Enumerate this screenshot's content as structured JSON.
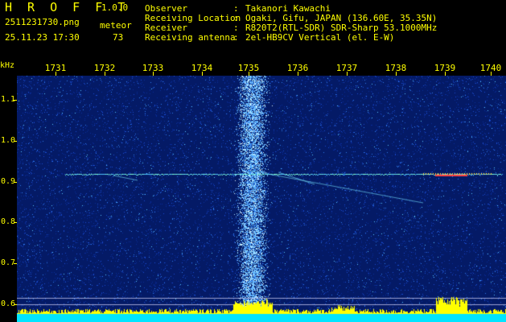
{
  "header": {
    "app_title": "H R O F F T",
    "version": "1.0.0",
    "file_name": "2511231730.png",
    "timestamp": "25.11.23 17:30",
    "meteor_label": "meteor",
    "meteor_count": "73",
    "info": [
      {
        "label": "Observer",
        "value": "Takanori Kawachi"
      },
      {
        "label": "Receiving Location",
        "value": "Ogaki, Gifu, JAPAN (136.60E, 35.35N)"
      },
      {
        "label": "Receiver",
        "value": "R820T2(RTL-SDR) SDR-Sharp 53.1000MHz"
      },
      {
        "label": "Receiving antenna",
        "value": "2el-HB9CV Vertical (el. E-W)"
      }
    ]
  },
  "axes": {
    "y_unit": "kHz",
    "x_ticks": [
      "1731",
      "1732",
      "1733",
      "1734",
      "1735",
      "1736",
      "1737",
      "1738",
      "1739",
      "1740"
    ],
    "y_ticks": [
      "1.1",
      "1.0",
      "0.9",
      "0.8",
      "0.7",
      "0.6"
    ]
  },
  "colors": {
    "background": "#041a66",
    "axis": "#ffff00",
    "noise_band": "#8fd0ff",
    "trace": "#7fffd4",
    "baseline": "#00e5ff"
  }
}
